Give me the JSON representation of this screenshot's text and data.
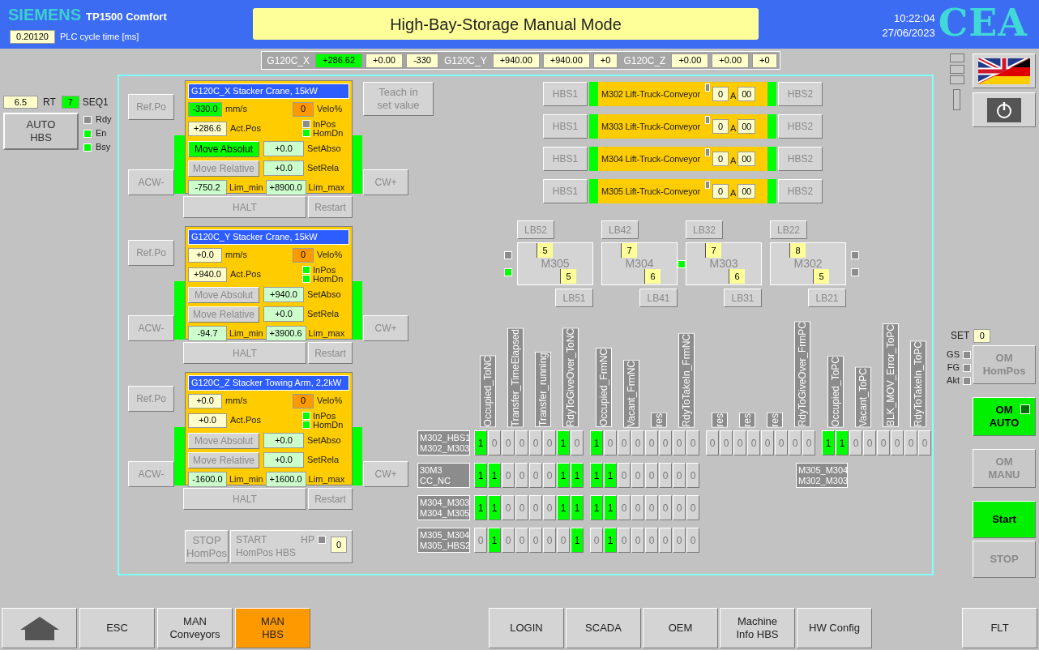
{
  "header": {
    "brand": "SIEMENS",
    "model": "TP1500 Comfort",
    "cycle_time": "0.20120",
    "cycle_label": "PLC cycle time [ms]",
    "title": "High-Bay-Storage Manual Mode",
    "time": "10:22:04",
    "date": "27/06/2023",
    "logo": "CEA"
  },
  "drive_bar": [
    {
      "kind": "label",
      "text": "G120C_X"
    },
    {
      "kind": "value",
      "text": "+286.62",
      "highlight": true
    },
    {
      "kind": "value",
      "text": "+0.00",
      "highlight": false
    },
    {
      "kind": "value",
      "text": "-330",
      "highlight": false
    },
    {
      "kind": "label",
      "text": "G120C_Y"
    },
    {
      "kind": "value",
      "text": "+940.00",
      "highlight": false
    },
    {
      "kind": "value",
      "text": "+940.00",
      "highlight": false
    },
    {
      "kind": "value",
      "text": "+0",
      "highlight": false
    },
    {
      "kind": "label",
      "text": "G120C_Z"
    },
    {
      "kind": "value",
      "text": "+0.00",
      "highlight": false
    },
    {
      "kind": "value",
      "text": "+0.00",
      "highlight": false
    },
    {
      "kind": "value",
      "text": "+0",
      "highlight": false
    }
  ],
  "left_status": {
    "setpoint": "6.5",
    "rt_label": "RT",
    "seq_value": "7",
    "seq_label": "SEQ1",
    "auto_button": "AUTO\nHBS",
    "lamps": [
      {
        "label": "Rdy",
        "on": false
      },
      {
        "label": "En",
        "on": true
      },
      {
        "label": "Bsy",
        "on": true
      }
    ]
  },
  "teach_button": "Teach in\nset value",
  "drives": [
    {
      "title": "G120C_X Stacker Crane, 15kW",
      "ref_button": "Ref.Po",
      "acw_button": "ACW-",
      "cw_button": "CW+",
      "halt_button": "HALT",
      "restart_button": "Restart",
      "velocity": {
        "value": "-330.0",
        "active": true
      },
      "velocity_unit": "mm/s",
      "velo_pct": "0",
      "velo_pct_label": "Velo%",
      "act_pos": "+286.6",
      "act_pos_label": "Act.Pos",
      "lamps": [
        {
          "label": "InPos",
          "on": false
        },
        {
          "label": "HomDn",
          "on": true
        }
      ],
      "move_absolute": {
        "label": "Move Absolut",
        "active": true
      },
      "set_abs": "+0.0",
      "set_abs_label": "SetAbso",
      "move_relative": {
        "label": "Move Relative",
        "active": false
      },
      "set_rel": "+0.0",
      "set_rel_label": "SetRela",
      "lim_min": "-750.2",
      "lim_min_label": "Lim_min",
      "lim_max": "+8900.0",
      "lim_max_label": "Lim_max"
    },
    {
      "title": "G120C_Y Stacker Crane, 15kW",
      "ref_button": "Ref.Po",
      "acw_button": "ACW-",
      "cw_button": "CW+",
      "halt_button": "HALT",
      "restart_button": "Restart",
      "velocity": {
        "value": "+0.0",
        "active": false
      },
      "velocity_unit": "mm/s",
      "velo_pct": "0",
      "velo_pct_label": "Velo%",
      "act_pos": "+940.0",
      "act_pos_label": "Act.Pos",
      "lamps": [
        {
          "label": "InPos",
          "on": true
        },
        {
          "label": "HomDn",
          "on": true
        }
      ],
      "move_absolute": {
        "label": "Move Absolut",
        "active": false
      },
      "set_abs": "+940.0",
      "set_abs_label": "SetAbso",
      "move_relative": {
        "label": "Move Relative",
        "active": false
      },
      "set_rel": "+0.0",
      "set_rel_label": "SetRela",
      "lim_min": "-94.7",
      "lim_min_label": "Lim_min",
      "lim_max": "+3900.6",
      "lim_max_label": "Lim_max"
    },
    {
      "title": "G120C_Z Stacker Towing Arm, 2,2kW",
      "ref_button": "Ref.Po",
      "acw_button": "ACW-",
      "cw_button": "CW+",
      "halt_button": "HALT",
      "restart_button": "Restart",
      "velocity": {
        "value": "+0.0",
        "active": false
      },
      "velocity_unit": "mm/s",
      "velo_pct": "0",
      "velo_pct_label": "Velo%",
      "act_pos": "+0.0",
      "act_pos_label": "Act.Pos",
      "lamps": [
        {
          "label": "InPos",
          "on": true
        },
        {
          "label": "HomDn",
          "on": true
        }
      ],
      "move_absolute": {
        "label": "Move Absolut",
        "active": false
      },
      "set_abs": "+0.0",
      "set_abs_label": "SetAbso",
      "move_relative": {
        "label": "Move Relative",
        "active": false
      },
      "set_rel": "+0.0",
      "set_rel_label": "SetRela",
      "lim_min": "-1600.0",
      "lim_min_label": "Lim_min",
      "lim_max": "+1600.0",
      "lim_max_label": "Lim_max"
    }
  ],
  "homing": {
    "stop_button": "STOP\nHomPos",
    "start_button": "START\nHomPos HBS",
    "hp_label": "HP",
    "hp_on": false,
    "hp_value": "0"
  },
  "conveyors": [
    {
      "left_button": "HBS1",
      "name": "M302 Lift-Truck-Conveyor",
      "lamp_on": false,
      "current": "0",
      "unit": "A",
      "code": "00",
      "right_button": "HBS2"
    },
    {
      "left_button": "HBS1",
      "name": "M303 Lift-Truck-Conveyor",
      "lamp_on": false,
      "current": "0",
      "unit": "A",
      "code": "00",
      "right_button": "HBS2"
    },
    {
      "left_button": "HBS1",
      "name": "M304 Lift-Truck-Conveyor",
      "lamp_on": false,
      "current": "0",
      "unit": "A",
      "code": "00",
      "right_button": "HBS2"
    },
    {
      "left_button": "HBS1",
      "name": "M305 Lift-Truck-Conveyor",
      "lamp_on": false,
      "current": "0",
      "unit": "A",
      "code": "00",
      "right_button": "HBS2"
    }
  ],
  "light_barriers": [
    {
      "top": "LB52",
      "name": "M305",
      "top_value": "5",
      "bottom_value": "5",
      "bottom": "LB51",
      "lamps_before": [
        {
          "on": false
        },
        {
          "on": true
        }
      ]
    },
    {
      "top": "LB42",
      "name": "M304",
      "top_value": "7",
      "bottom_value": "6",
      "bottom": "LB41",
      "lamps_after": [
        {
          "on": true
        }
      ]
    },
    {
      "top": "LB32",
      "name": "M303",
      "top_value": "7",
      "bottom_value": "6",
      "bottom": "LB31"
    },
    {
      "top": "LB22",
      "name": "M302",
      "top_value": "8",
      "bottom_value": "5",
      "bottom": "LB21",
      "lamps_after": [
        {
          "on": false
        },
        {
          "on": false
        }
      ]
    }
  ],
  "signals": {
    "groups": [
      {
        "headers": [
          "Occupied_ToNC",
          "Transfer_TimeElapsed",
          "Transfer_running",
          "RdyToGiveOver_ToNC"
        ]
      },
      {
        "headers": [
          "Occupied_FrmNC",
          "Vacant_FrmNC",
          "res",
          "RdyToTakeIn_FrmNC"
        ]
      },
      {
        "headers": [
          "res",
          "res",
          "res",
          "RdyToGiveOver_FrmPC"
        ]
      },
      {
        "headers": [
          "Occupied_ToPC",
          "Vacant_ToPC",
          "BLK_MOV_Error_ToPC",
          "RdyToTakeIn_ToPC"
        ]
      }
    ],
    "rows": [
      {
        "label": "M302_HBS1\nM302_M303",
        "groups": [
          [
            {
              "value": "1",
              "on": true
            },
            {
              "value": "0",
              "on": false
            },
            {
              "value": "0",
              "on": false
            },
            {
              "value": "0",
              "on": false
            },
            {
              "value": "0",
              "on": false
            },
            {
              "value": "0",
              "on": false
            },
            {
              "value": "1",
              "on": true
            },
            {
              "value": "0",
              "on": false
            }
          ],
          [
            {
              "value": "1",
              "on": true
            },
            {
              "value": "0",
              "on": false
            },
            {
              "value": "0",
              "on": false
            },
            {
              "value": "0",
              "on": false
            },
            {
              "value": "0",
              "on": false
            },
            {
              "value": "0",
              "on": false
            },
            {
              "value": "0",
              "on": false
            },
            {
              "value": "0",
              "on": false
            }
          ],
          [
            {
              "value": "0",
              "on": false
            },
            {
              "value": "0",
              "on": false
            },
            {
              "value": "0",
              "on": false
            },
            {
              "value": "0",
              "on": false
            },
            {
              "value": "0",
              "on": false
            },
            {
              "value": "0",
              "on": false
            },
            {
              "value": "0",
              "on": false
            },
            {
              "value": "0",
              "on": false
            }
          ],
          [
            {
              "value": "1",
              "on": true
            },
            {
              "value": "1",
              "on": true
            },
            {
              "value": "0",
              "on": false
            },
            {
              "value": "0",
              "on": false
            },
            {
              "value": "0",
              "on": false
            },
            {
              "value": "0",
              "on": false
            },
            {
              "value": "0",
              "on": false
            },
            {
              "value": "0",
              "on": false
            }
          ]
        ]
      },
      {
        "label": "30M3\nCC_NC",
        "note": "M305_M304\nM302_M303",
        "groups": [
          [
            {
              "value": "1",
              "on": true
            },
            {
              "value": "1",
              "on": true
            },
            {
              "value": "0",
              "on": false
            },
            {
              "value": "0",
              "on": false
            },
            {
              "value": "0",
              "on": false
            },
            {
              "value": "0",
              "on": false
            },
            {
              "value": "1",
              "on": true
            },
            {
              "value": "1",
              "on": true
            }
          ],
          [
            {
              "value": "1",
              "on": true
            },
            {
              "value": "1",
              "on": true
            },
            {
              "value": "0",
              "on": false
            },
            {
              "value": "0",
              "on": false
            },
            {
              "value": "0",
              "on": false
            },
            {
              "value": "0",
              "on": false
            },
            {
              "value": "0",
              "on": false
            },
            {
              "value": "0",
              "on": false
            }
          ]
        ]
      },
      {
        "label": "M304_M303\nM304_M305",
        "groups": [
          [
            {
              "value": "1",
              "on": true
            },
            {
              "value": "1",
              "on": true
            },
            {
              "value": "0",
              "on": false
            },
            {
              "value": "0",
              "on": false
            },
            {
              "value": "0",
              "on": false
            },
            {
              "value": "0",
              "on": false
            },
            {
              "value": "1",
              "on": true
            },
            {
              "value": "1",
              "on": true
            }
          ],
          [
            {
              "value": "1",
              "on": true
            },
            {
              "value": "1",
              "on": true
            },
            {
              "value": "0",
              "on": false
            },
            {
              "value": "0",
              "on": false
            },
            {
              "value": "0",
              "on": false
            },
            {
              "value": "0",
              "on": false
            },
            {
              "value": "0",
              "on": false
            },
            {
              "value": "0",
              "on": false
            }
          ]
        ]
      },
      {
        "label": "M305_M304\nM305_HBS2",
        "groups": [
          [
            {
              "value": "0",
              "on": false
            },
            {
              "value": "1",
              "on": true
            },
            {
              "value": "0",
              "on": false
            },
            {
              "value": "0",
              "on": false
            },
            {
              "value": "0",
              "on": false
            },
            {
              "value": "0",
              "on": false
            },
            {
              "value": "0",
              "on": false
            },
            {
              "value": "1",
              "on": true
            }
          ],
          [
            {
              "value": "0",
              "on": false
            },
            {
              "value": "1",
              "on": true
            },
            {
              "value": "0",
              "on": false
            },
            {
              "value": "0",
              "on": false
            },
            {
              "value": "0",
              "on": false
            },
            {
              "value": "0",
              "on": false
            },
            {
              "value": "0",
              "on": false
            },
            {
              "value": "0",
              "on": false
            }
          ]
        ]
      }
    ]
  },
  "right_panel": {
    "set_label": "SET",
    "set_value": "0",
    "lamps": [
      {
        "label": "GS",
        "on": false
      },
      {
        "label": "FG",
        "on": false
      },
      {
        "label": "Akt",
        "on": false
      }
    ],
    "mode_buttons": [
      {
        "label": "OM\nHomPos",
        "selected": false
      },
      {
        "label": "OM\nAUTO",
        "selected": true,
        "indicator": true
      },
      {
        "label": "OM\nMANU",
        "selected": false
      }
    ],
    "run_buttons": [
      {
        "label": "Start",
        "selected": true
      },
      {
        "label": "STOP",
        "selected": false
      }
    ]
  },
  "nav": {
    "left": [
      {
        "kind": "home",
        "selected": false
      },
      {
        "kind": "button",
        "label": "ESC",
        "selected": false
      },
      {
        "kind": "button",
        "label": "MAN\nConveyors",
        "selected": false
      },
      {
        "kind": "button",
        "label": "MAN\nHBS",
        "selected": true
      }
    ],
    "center": [
      {
        "kind": "button",
        "label": "LOGIN",
        "selected": false
      },
      {
        "kind": "button",
        "label": "SCADA",
        "selected": false
      },
      {
        "kind": "button",
        "label": "OEM",
        "selected": false
      },
      {
        "kind": "button",
        "label": "Machine\nInfo HBS",
        "selected": false
      },
      {
        "kind": "button",
        "label": "HW Config",
        "selected": false
      }
    ],
    "right": [
      {
        "kind": "button",
        "label": "FLT",
        "selected": false
      }
    ]
  }
}
